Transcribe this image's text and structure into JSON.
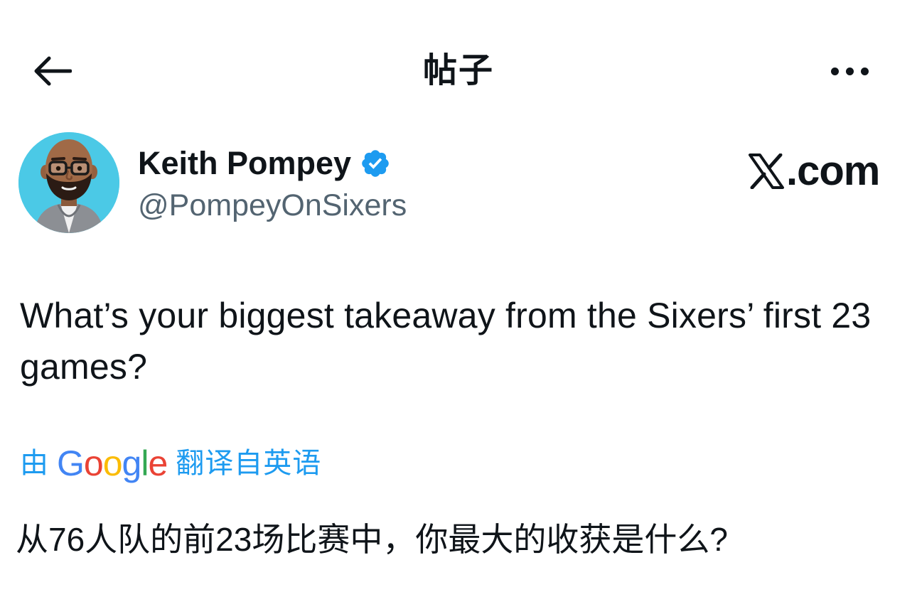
{
  "header": {
    "back_icon": "arrow-left-icon",
    "title": "帖子",
    "more_icon": "more-horizontal-icon"
  },
  "author": {
    "name": "Keith Pompey",
    "handle": "@PompeyOnSixers",
    "verified": true,
    "verified_color": "#1d9bf0",
    "avatar_bg": "#4bc9e6"
  },
  "watermark": {
    "text": ".com",
    "logo_icon": "x-logo-icon"
  },
  "tweet": {
    "text": "What’s your biggest takeaway from the Sixers’ first 23 games?"
  },
  "translation": {
    "by_label": "由",
    "provider": "Google",
    "from_label": "翻译自英语",
    "link_color": "#1d9bf0",
    "translated_text": "从76人队的前23场比赛中，你最大的收获是什么?"
  },
  "colors": {
    "text": "#0f1419",
    "secondary_text": "#536471",
    "accent": "#1d9bf0",
    "google_blue": "#4285f4",
    "google_red": "#ea4335",
    "google_yellow": "#fbbc05",
    "google_green": "#34a853"
  }
}
